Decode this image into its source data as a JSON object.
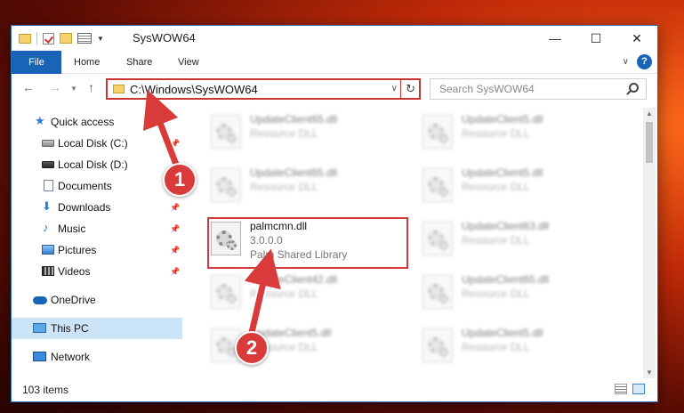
{
  "window": {
    "title": "SysWOW64",
    "controls": {
      "minimize": "—",
      "maximize": "☐",
      "close": "✕"
    }
  },
  "ribbon": {
    "tabs": [
      "File",
      "Home",
      "Share",
      "View"
    ],
    "help": "?"
  },
  "navigation": {
    "address": "C:\\Windows\\SysWOW64",
    "search_placeholder": "Search SysWOW64"
  },
  "sidebar": {
    "items": [
      {
        "label": "Quick access",
        "icon": "star-icon"
      },
      {
        "label": "Local Disk (C:)",
        "icon": "disk-icon",
        "pinned": true
      },
      {
        "label": "Local Disk (D:)",
        "icon": "disk-icon"
      },
      {
        "label": "Documents",
        "icon": "documents-icon",
        "pinned": true
      },
      {
        "label": "Downloads",
        "icon": "downloads-icon",
        "pinned": true
      },
      {
        "label": "Music",
        "icon": "music-icon",
        "pinned": true
      },
      {
        "label": "Pictures",
        "icon": "pictures-icon",
        "pinned": true
      },
      {
        "label": "Videos",
        "icon": "videos-icon",
        "pinned": true
      },
      {
        "label": "OneDrive",
        "icon": "onedrive-icon"
      },
      {
        "label": "This PC",
        "icon": "this-pc-icon",
        "selected": true
      },
      {
        "label": "Network",
        "icon": "network-icon"
      }
    ]
  },
  "files": {
    "left_column": [
      {
        "name": "UpdateClient65.dll",
        "sub1": "Resource DLL",
        "sub2": ""
      },
      {
        "name": "UpdateClient65.dll",
        "sub1": "Resource DLL",
        "sub2": ""
      },
      {
        "name": "palmcmn.dll",
        "sub1": "3.0.0.0",
        "sub2": "Palm Shared Library"
      },
      {
        "name": "UpdateClient42.dll",
        "sub1": "Resource DLL",
        "sub2": ""
      },
      {
        "name": "UpdateClient5.dll",
        "sub1": "Resource DLL",
        "sub2": ""
      }
    ],
    "right_column": [
      {
        "name": "UpdateClient5.dll",
        "sub1": "Resource DLL"
      },
      {
        "name": "UpdateClient5.dll",
        "sub1": "Resource DLL"
      },
      {
        "name": "UpdateClient63.dll",
        "sub1": "Resource DLL"
      },
      {
        "name": "UpdateClient65.dll",
        "sub1": "Resource DLL"
      },
      {
        "name": "UpdateClient5.dll",
        "sub1": "Resource DLL"
      }
    ]
  },
  "status": {
    "item_count": "103 items"
  },
  "annotations": {
    "callout_1": "1",
    "callout_2": "2",
    "color": "#d93b3b"
  }
}
